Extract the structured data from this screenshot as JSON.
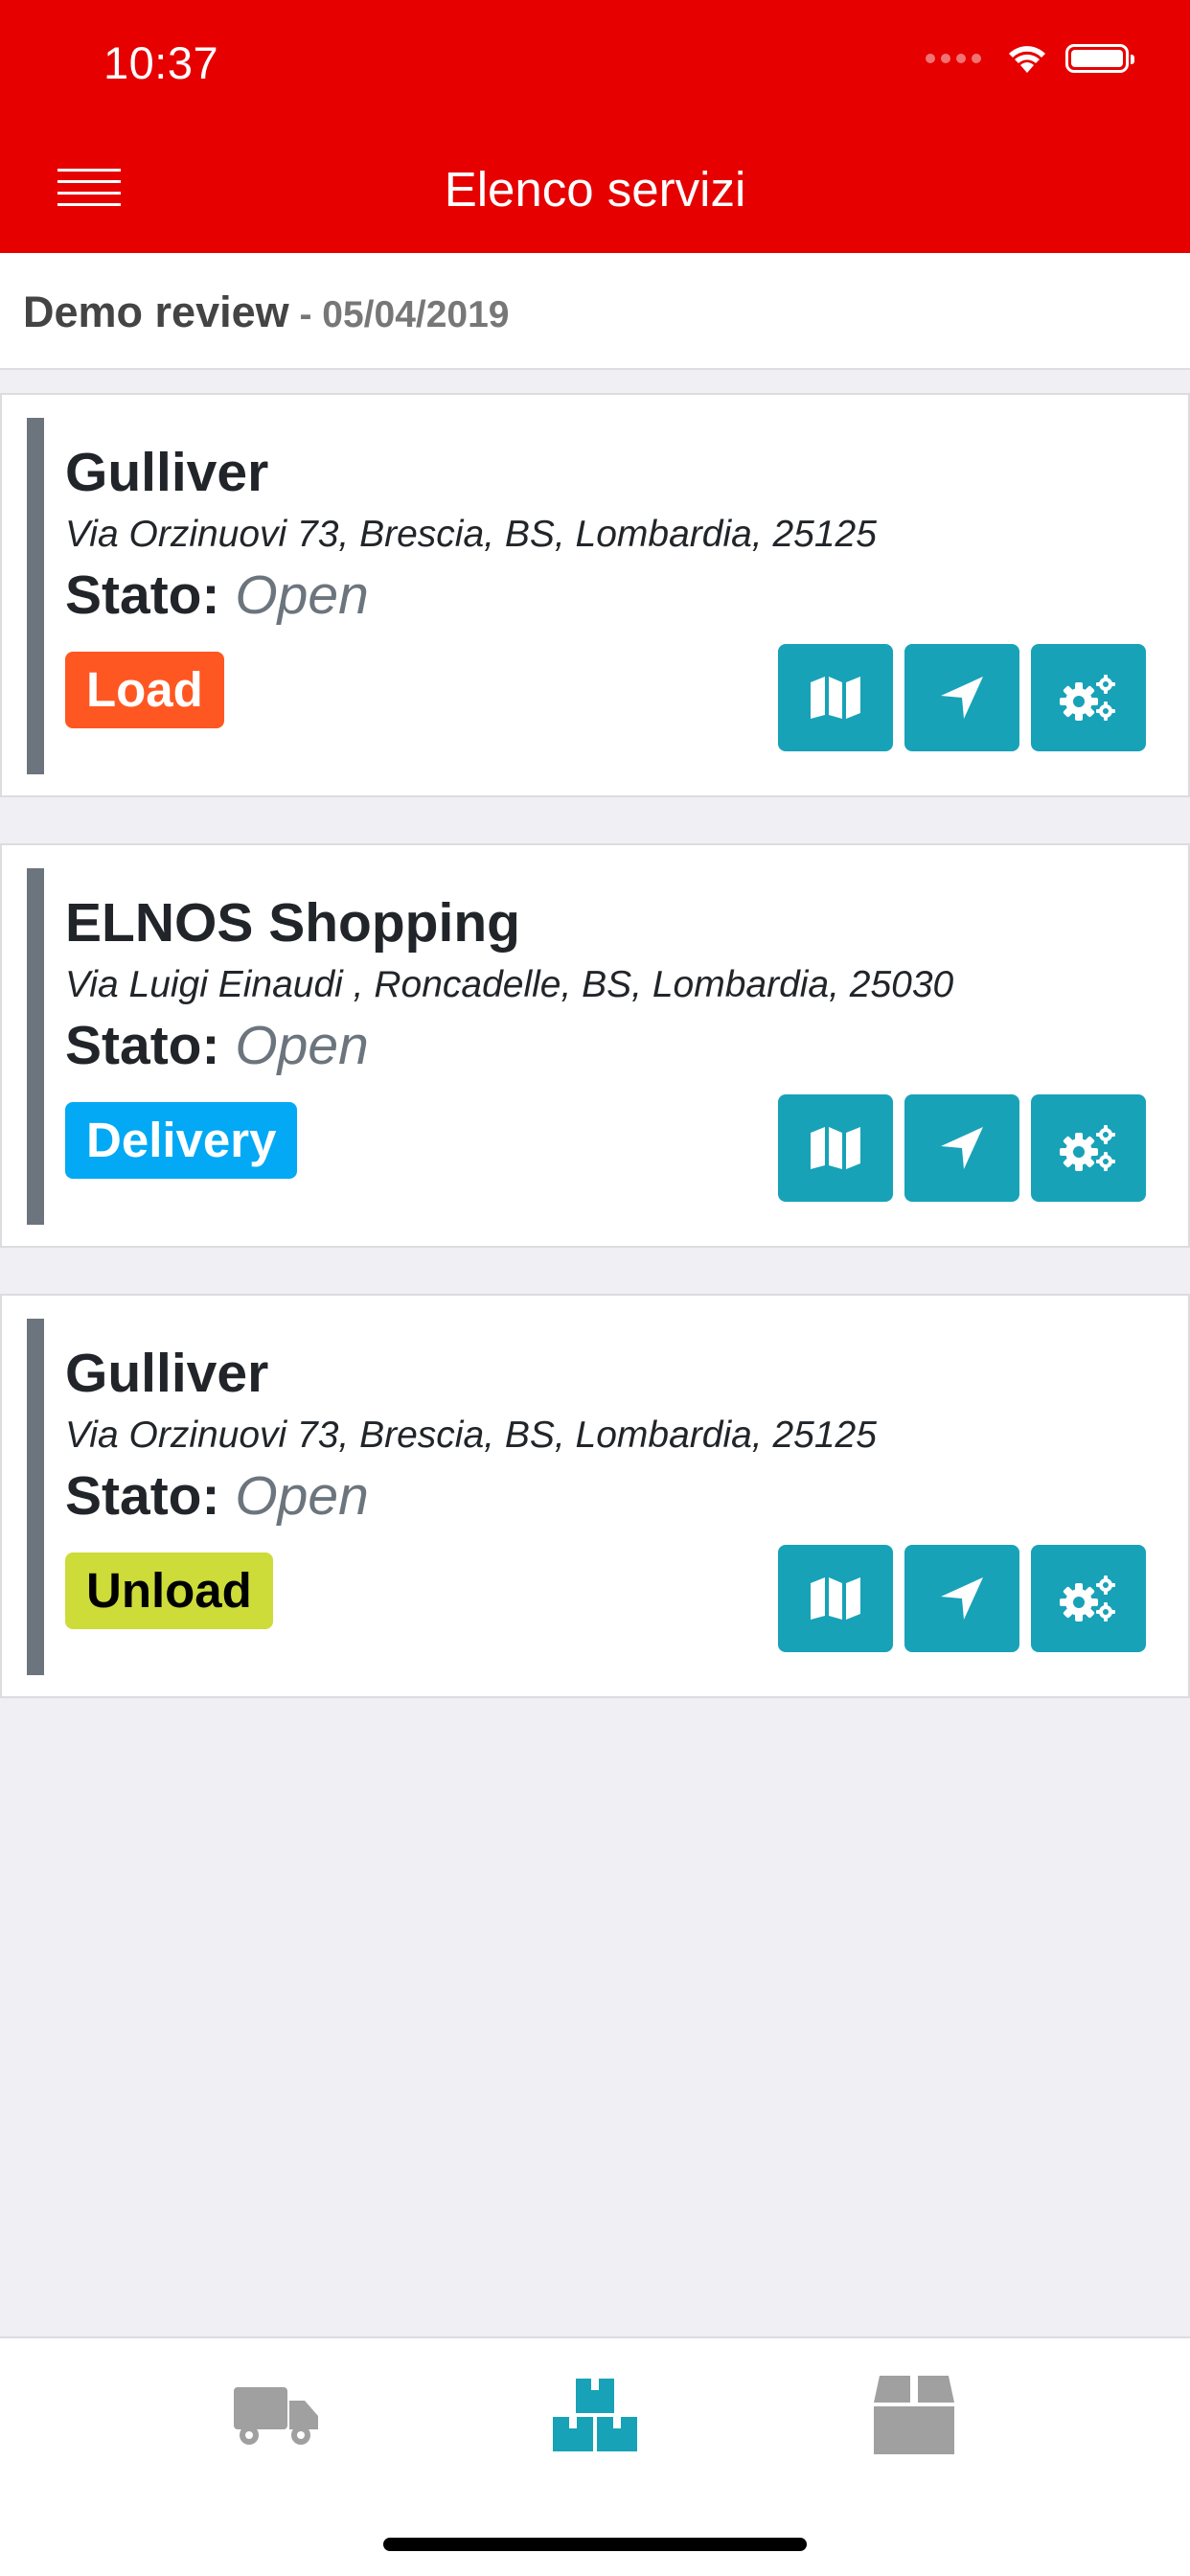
{
  "status_bar": {
    "time": "10:37"
  },
  "header": {
    "title": "Elenco servizi"
  },
  "subheader": {
    "name": "Demo review",
    "date": " - 05/04/2019"
  },
  "services": [
    {
      "title": "Gulliver",
      "address": "Via Orzinuovi 73, Brescia, BS, Lombardia, 25125",
      "status_label": "Stato:",
      "status_value": "Open",
      "badge": "Load"
    },
    {
      "title": "ELNOS Shopping",
      "address": "Via Luigi Einaudi , Roncadelle, BS, Lombardia, 25030",
      "status_label": "Stato:",
      "status_value": "Open",
      "badge": "Delivery"
    },
    {
      "title": "Gulliver",
      "address": "Via Orzinuovi 73, Brescia, BS, Lombardia, 25125",
      "status_label": "Stato:",
      "status_value": "Open",
      "badge": "Unload"
    }
  ],
  "icons": [
    "map-icon",
    "navigate-icon",
    "cogs-icon",
    "truck-icon",
    "boxes-icon",
    "box-icon"
  ],
  "colors": {
    "header": "#e60000",
    "action_button": "#17a2b8",
    "badge_load": "#ff5722",
    "badge_delivery": "#03a9f4",
    "badge_unload": "#cddc39",
    "tab_active": "#17a2b8",
    "tab_inactive": "#a0a0a0"
  },
  "tabs": [
    {
      "name": "truck",
      "active": false
    },
    {
      "name": "boxes",
      "active": true
    },
    {
      "name": "box",
      "active": false
    }
  ]
}
